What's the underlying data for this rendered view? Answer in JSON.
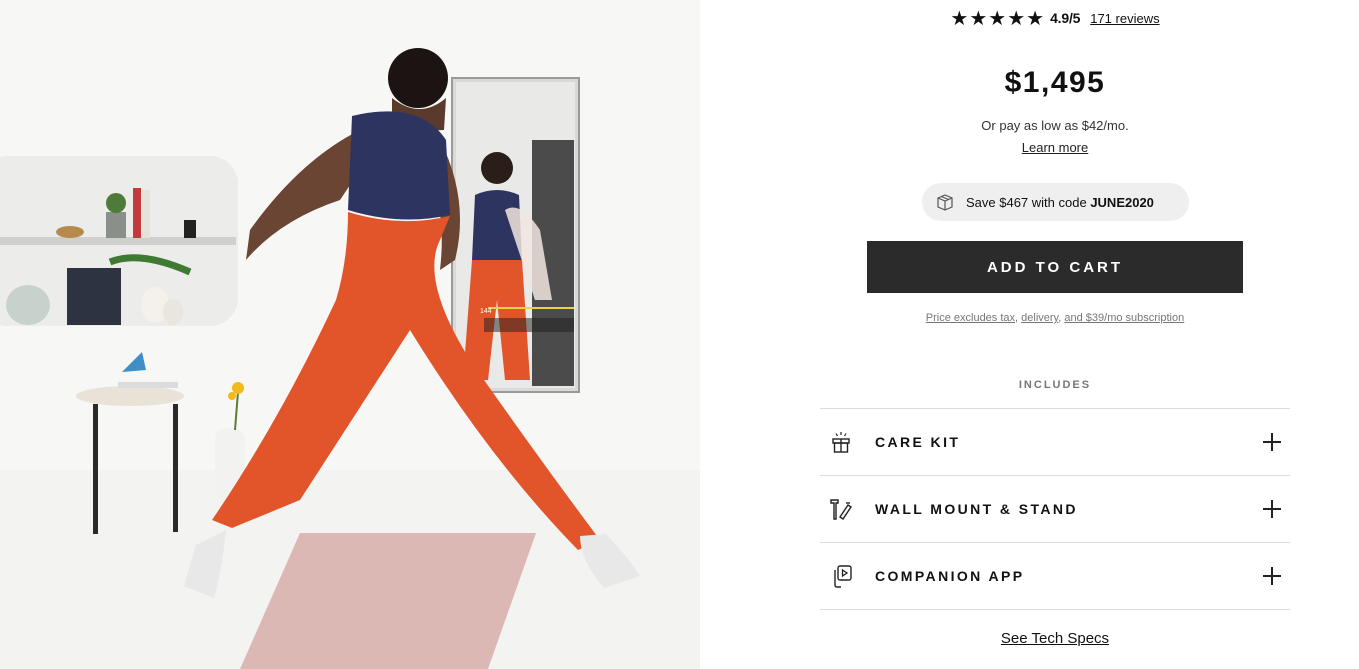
{
  "hero": {
    "mirror_readout": "144"
  },
  "rating": {
    "stars": [
      "★",
      "★",
      "★",
      "★",
      "★"
    ],
    "score": "4.9/5",
    "reviews": "171 reviews",
    "value": 4.9,
    "max": 5
  },
  "price": "$1,495",
  "financing": "Or pay as low as $42/mo.",
  "learn_more": "Learn more",
  "promo": {
    "text": "Save $467 with code ",
    "code": "JUNE2020",
    "icon": "gift-box-icon"
  },
  "cta": {
    "add_to_cart": "ADD TO CART"
  },
  "disclaimer": {
    "price_excludes_tax": "Price excludes tax",
    "sep1": ", ",
    "delivery": "delivery",
    "sep2": ", ",
    "subscription": "and $39/mo subscription"
  },
  "includes": {
    "title": "INCLUDES",
    "items": [
      {
        "label": "CARE KIT",
        "icon": "gift-icon"
      },
      {
        "label": "WALL MOUNT & STAND",
        "icon": "tools-icon"
      },
      {
        "label": "COMPANION APP",
        "icon": "phone-app-icon"
      }
    ]
  },
  "tech_specs": "See Tech Specs",
  "colors": {
    "cta_bg": "#2b2b2b",
    "promo_bg": "#efefef",
    "divider": "#dcdcdc",
    "leggings": "#e2542a",
    "top": "#2e3460"
  }
}
